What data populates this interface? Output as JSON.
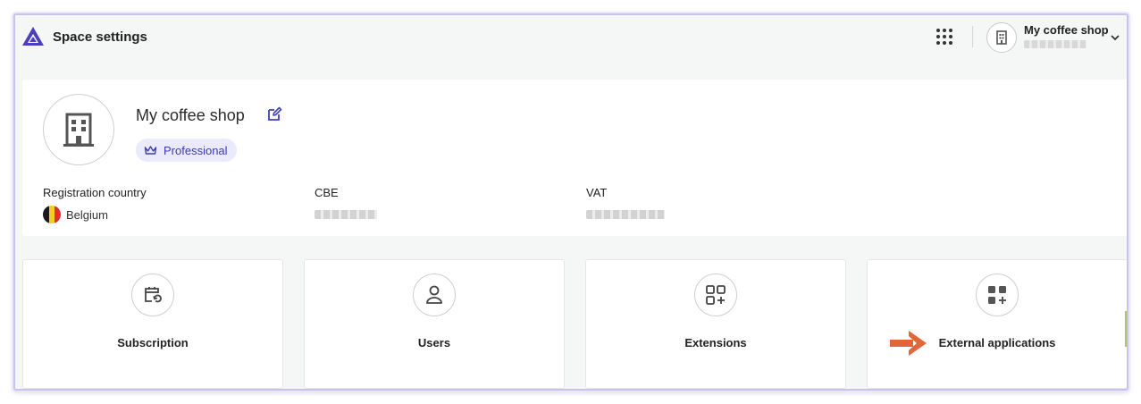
{
  "header": {
    "app_title": "Space settings",
    "logo_icon": "triangle-logo-icon",
    "apps_icon": "grid-dots-icon",
    "account": {
      "name": "My coffee shop",
      "avatar_icon": "building-icon",
      "chevron_icon": "chevron-down-icon"
    }
  },
  "profile": {
    "name": "My coffee shop",
    "edit_icon": "edit-icon",
    "plan": {
      "label": "Professional",
      "icon": "crown-icon"
    },
    "fields": {
      "country_label": "Registration country",
      "country_value": "Belgium",
      "cbe_label": "CBE",
      "vat_label": "VAT"
    }
  },
  "tiles": [
    {
      "label": "Subscription",
      "icon": "calendar-refresh-icon"
    },
    {
      "label": "Users",
      "icon": "user-icon"
    },
    {
      "label": "Extensions",
      "icon": "grid-plus-icon"
    },
    {
      "label": "External applications",
      "icon": "filled-grid-plus-icon"
    }
  ],
  "colors": {
    "accent": "#4040b8",
    "badge_bg": "#eaeafc",
    "annotation_arrow": "#e0663c",
    "flag_black": "#1a1a1a",
    "flag_yellow": "#f5cd1c",
    "flag_red": "#e32b2b"
  }
}
